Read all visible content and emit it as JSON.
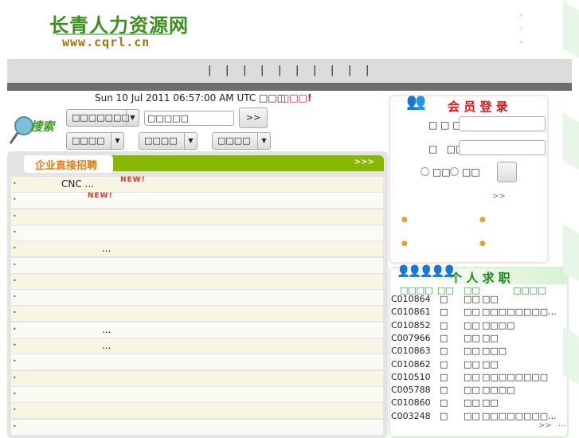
{
  "logo": {
    "name": "长青人力资源网",
    "url": "www.cqrl.cn"
  },
  "header_links": [
    "›",
    "›",
    "›"
  ],
  "nav": {
    "separators": [
      "|",
      "|",
      "|",
      "|",
      "|",
      "|",
      "|",
      "|",
      "|",
      "|"
    ]
  },
  "date": "Sun 10 Jul 2011 06:57:00 AM UTC □□□",
  "slogan": "□□□!",
  "search": {
    "label": "搜索",
    "category": "□□□□□□□",
    "keyword": "□□□□□",
    "go": ">>",
    "selects": [
      "□□□□",
      "□□□□",
      "□□□□"
    ]
  },
  "company": {
    "title": "企业直接招聘",
    "more": ">>>",
    "rows": [
      {
        "text": "CNC ...",
        "new": "NEW!"
      },
      {
        "text": "",
        "new": "NEW!"
      },
      {
        "text": "",
        "new": ""
      },
      {
        "text": "",
        "new": ""
      },
      {
        "text": "...",
        "new": ""
      },
      {
        "text": "",
        "new": ""
      },
      {
        "text": "",
        "new": ""
      },
      {
        "text": "",
        "new": ""
      },
      {
        "text": "",
        "new": ""
      },
      {
        "text": "...",
        "new": ""
      },
      {
        "text": "...",
        "new": ""
      },
      {
        "text": "",
        "new": ""
      },
      {
        "text": "",
        "new": ""
      },
      {
        "text": "",
        "new": ""
      },
      {
        "text": "",
        "new": ""
      },
      {
        "text": "",
        "new": ""
      }
    ]
  },
  "login": {
    "title": "会 员 登 录",
    "user_label": "□ □ □□",
    "pass_label": "□   □□",
    "radio1": "□□",
    "radio2": "□□",
    "more": ">>"
  },
  "jobs": {
    "title": "个 人 求 职",
    "headers": [
      "□□□□",
      "□□",
      "□□",
      "□□□□"
    ],
    "rows": [
      [
        "C010864",
        "□",
        "□□",
        "□□"
      ],
      [
        "C010861",
        "□",
        "□□",
        "□□□□□□□□..."
      ],
      [
        "C010852",
        "□",
        "□□",
        "□□□□"
      ],
      [
        "C007966",
        "□",
        "□□",
        "□□"
      ],
      [
        "C010863",
        "□",
        "□□",
        "□□□"
      ],
      [
        "C010862",
        "□",
        "□□",
        "□□"
      ],
      [
        "C010510",
        "□",
        "□□",
        "□□□□□□□□"
      ],
      [
        "C005788",
        "□",
        "□□",
        "□□□□"
      ],
      [
        "C010860",
        "□",
        "□□",
        "□□"
      ],
      [
        "C003248",
        "□",
        "□□",
        "□□□□□□□□..."
      ]
    ],
    "more": ">>",
    "ellipsis": "..."
  }
}
